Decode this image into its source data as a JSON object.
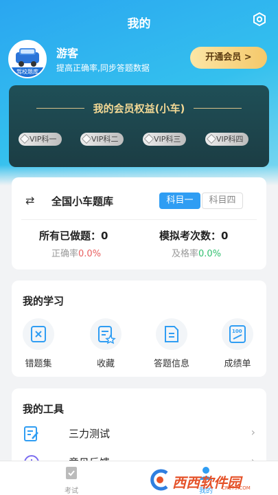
{
  "header": {
    "title": "我的",
    "settings_icon": "settings-icon"
  },
  "profile": {
    "name": "游客",
    "subtitle": "提高正确率,同步答题数据",
    "avatar_banner": "驾校题库",
    "vip_button": "开通会员 >"
  },
  "vip": {
    "title": "我的会员权益(小车)",
    "chips": [
      "VIP科一",
      "VIP科二",
      "VIP科三",
      "VIP科四"
    ]
  },
  "bank": {
    "swap_icon": "swap-icon",
    "title": "全国小车题库",
    "tabs": [
      "科目一",
      "科目四"
    ],
    "done_label": "所有已做题：0",
    "accuracy_label": "正确率",
    "accuracy_value": "0.0%",
    "exams_label": "模拟考次数：0",
    "pass_label": "及格率",
    "pass_value": "0.0%"
  },
  "study": {
    "title": "我的学习",
    "items": [
      {
        "label": "错题集",
        "icon": "wrong-questions-icon"
      },
      {
        "label": "收藏",
        "icon": "favorite-icon"
      },
      {
        "label": "答题信息",
        "icon": "answer-info-icon"
      },
      {
        "label": "成绩单",
        "icon": "report-card-icon"
      }
    ]
  },
  "tools": {
    "title": "我的工具",
    "items": [
      {
        "label": "三力测试",
        "icon": "edit-icon"
      },
      {
        "label": "意见反馈",
        "icon": "feedback-icon"
      }
    ]
  },
  "tabbar": {
    "items": [
      {
        "label": "考试",
        "icon": "exam-icon"
      },
      {
        "label": "我的",
        "icon": "profile-icon"
      }
    ]
  },
  "watermark": {
    "text": "西西软件园",
    "sub": "CR173.COM"
  },
  "colors": {
    "primary": "#2f9df3",
    "gold": "#f4d995",
    "red": "#e85d5d",
    "green": "#2fbf6e"
  }
}
